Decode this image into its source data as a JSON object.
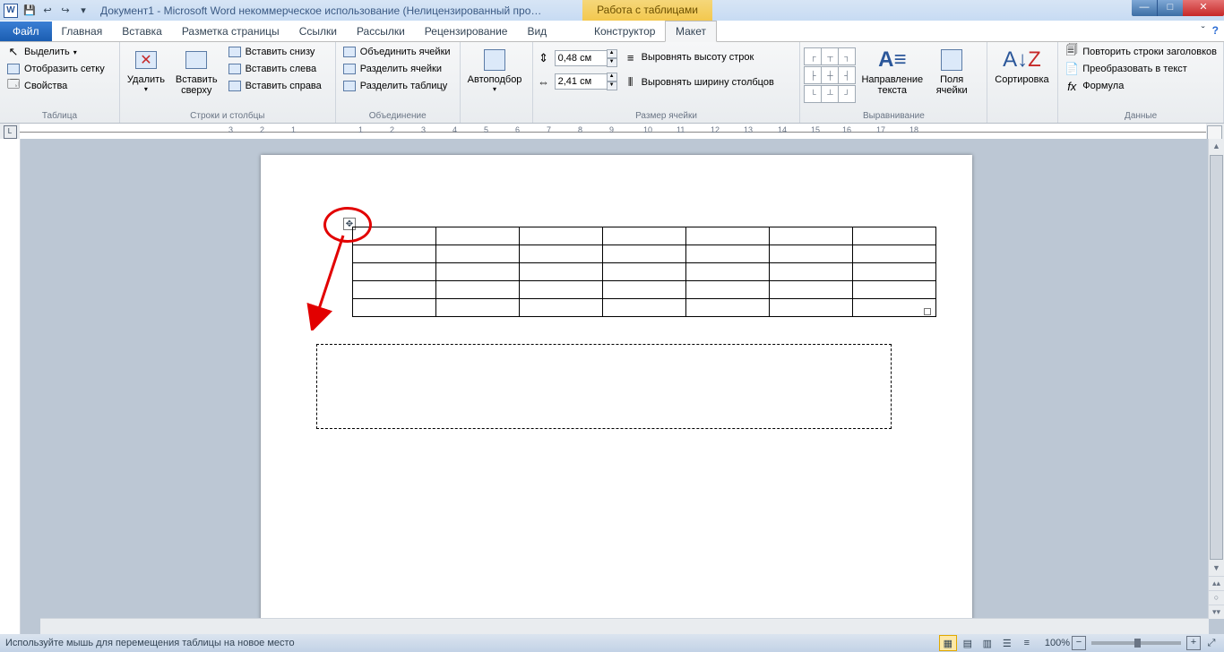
{
  "titlebar": {
    "doc_title": "Документ1 - Microsoft Word некоммерческое использование (Нелицензированный про…",
    "context_title": "Работа с таблицами"
  },
  "tabs": {
    "file": "Файл",
    "items": [
      "Главная",
      "Вставка",
      "Разметка страницы",
      "Ссылки",
      "Рассылки",
      "Рецензирование",
      "Вид"
    ],
    "ctx1": "Конструктор",
    "ctx2": "Макет"
  },
  "ribbon": {
    "g_table": {
      "label": "Таблица",
      "select": "Выделить",
      "gridlines": "Отобразить сетку",
      "properties": "Свойства"
    },
    "g_rows": {
      "label": "Строки и столбцы",
      "delete": "Удалить",
      "insert_above": "Вставить\nсверху",
      "insert_below": "Вставить снизу",
      "insert_left": "Вставить слева",
      "insert_right": "Вставить справа"
    },
    "g_merge": {
      "label": "Объединение",
      "merge": "Объединить ячейки",
      "split_cells": "Разделить ячейки",
      "split_table": "Разделить таблицу"
    },
    "g_size": {
      "label": "Размер ячейки",
      "autofit": "Автоподбор",
      "height": "0,48 см",
      "width": "2,41 см",
      "dist_rows": "Выровнять высоту строк",
      "dist_cols": "Выровнять ширину столбцов"
    },
    "g_align": {
      "label": "Выравнивание",
      "textdir": "Направление\nтекста",
      "margins": "Поля\nячейки"
    },
    "g_sort": {
      "label": "",
      "sort": "Сортировка"
    },
    "g_data": {
      "label": "Данные",
      "repeat": "Повторить строки заголовков",
      "convert": "Преобразовать в текст",
      "formula": "Формула"
    }
  },
  "ruler_ticks": [
    "3",
    "2",
    "1",
    "1",
    "2",
    "3",
    "4",
    "5",
    "6",
    "7",
    "8",
    "9",
    "10",
    "11",
    "12",
    "13",
    "14",
    "15",
    "16",
    "17",
    "18"
  ],
  "statusbar": {
    "msg": "Используйте мышь для перемещения таблицы на новое место",
    "zoom": "100%"
  }
}
